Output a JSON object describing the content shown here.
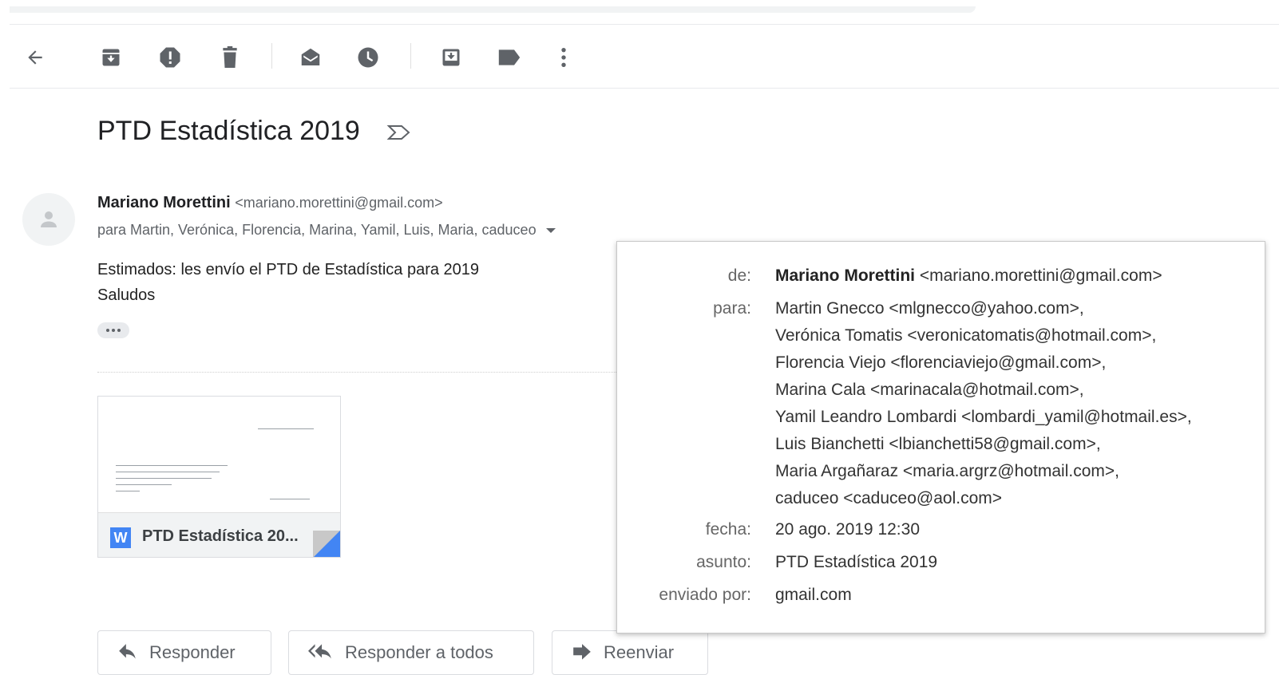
{
  "toolbar": {
    "back": "back-arrow-icon",
    "icons": [
      "archive-icon",
      "report-spam-icon",
      "delete-icon",
      "mark-unread-icon",
      "snooze-icon",
      "move-to-icon",
      "label-icon",
      "more-vert-icon"
    ]
  },
  "email": {
    "subject": "PTD Estadística 2019",
    "sender_name": "Mariano Morettini",
    "sender_email": "<mariano.morettini@gmail.com>",
    "to_summary": "para Martin, Verónica, Florencia, Marina, Yamil, Luis, Maria, caduceo",
    "body_line1": "Estimados: les envío el PTD de Estadística para 2019",
    "body_line2": "Saludos"
  },
  "attachment": {
    "name": "PTD Estadística 20...",
    "type_icon": "W"
  },
  "actions": {
    "reply": "Responder",
    "reply_all": "Responder a todos",
    "forward": "Reenviar"
  },
  "details": {
    "from_label": "de:",
    "from_name": "Mariano Morettini",
    "from_email": "<mariano.morettini@gmail.com>",
    "to_label": "para:",
    "recipients": [
      "Martin Gnecco <mlgnecco@yahoo.com>,",
      "Verónica Tomatis <veronicatomatis@hotmail.com>,",
      "Florencia Viejo <florenciaviejo@gmail.com>,",
      "Marina Cala <marinacala@hotmail.com>,",
      "Yamil Leandro Lombardi <lombardi_yamil@hotmail.es>,",
      "Luis Bianchetti <lbianchetti58@gmail.com>,",
      "Maria Argañaraz <maria.argrz@hotmail.com>,",
      "caduceo <caduceo@aol.com>"
    ],
    "date_label": "fecha:",
    "date": "20 ago. 2019 12:30",
    "subject_label": "asunto:",
    "subject": "PTD Estadística 2019",
    "sent_by_label": "enviado por:",
    "sent_by": "gmail.com"
  }
}
